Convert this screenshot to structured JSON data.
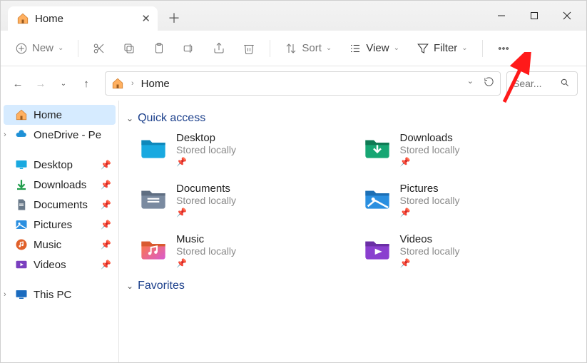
{
  "titlebar": {
    "tab_title": "Home"
  },
  "toolbar": {
    "new_label": "New",
    "sort_label": "Sort",
    "view_label": "View",
    "filter_label": "Filter"
  },
  "nav": {
    "address": "Home",
    "search_placeholder": "Sear..."
  },
  "sidebar": {
    "home": "Home",
    "onedrive": "OneDrive - Pe",
    "desktop": "Desktop",
    "downloads": "Downloads",
    "documents": "Documents",
    "pictures": "Pictures",
    "music": "Music",
    "videos": "Videos",
    "thispc": "This PC"
  },
  "sections": {
    "quick_access": "Quick access",
    "favorites": "Favorites"
  },
  "quick": {
    "stored_locally": "Stored locally",
    "desktop": "Desktop",
    "downloads": "Downloads",
    "documents": "Documents",
    "pictures": "Pictures",
    "music": "Music",
    "videos": "Videos"
  }
}
